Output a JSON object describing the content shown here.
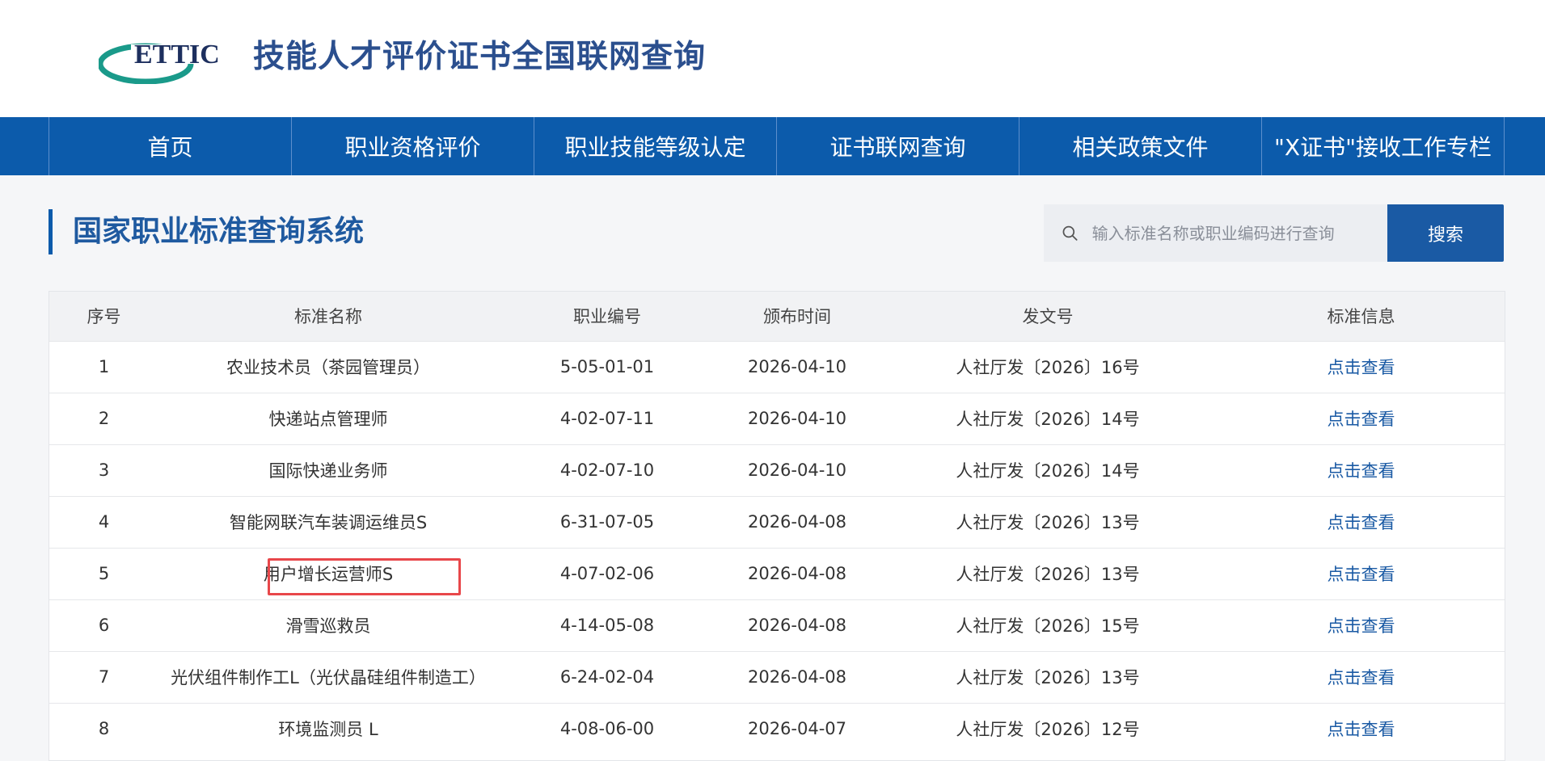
{
  "header": {
    "logo_text": "ETTIC",
    "site_title": "技能人才评价证书全国联网查询"
  },
  "nav": {
    "items": [
      {
        "label": "首页"
      },
      {
        "label": "职业资格评价"
      },
      {
        "label": "职业技能等级认定"
      },
      {
        "label": "证书联网查询"
      },
      {
        "label": "相关政策文件"
      },
      {
        "label": "\"X证书\"接收工作专栏"
      }
    ]
  },
  "main": {
    "page_title": "国家职业标准查询系统",
    "search": {
      "placeholder": "输入标准名称或职业编码进行查询",
      "button_label": "搜索",
      "icon": "search-icon"
    }
  },
  "table": {
    "columns": [
      "序号",
      "标准名称",
      "职业编号",
      "颁布时间",
      "发文号",
      "标准信息"
    ],
    "rows": [
      {
        "index": "1",
        "name": "农业技术员（茶园管理员）",
        "code": "5-05-01-01",
        "date": "2026-04-10",
        "doc": "人社厅发〔2026〕16号",
        "action": "点击查看"
      },
      {
        "index": "2",
        "name": "快递站点管理师",
        "code": "4-02-07-11",
        "date": "2026-04-10",
        "doc": "人社厅发〔2026〕14号",
        "action": "点击查看"
      },
      {
        "index": "3",
        "name": "国际快递业务师",
        "code": "4-02-07-10",
        "date": "2026-04-10",
        "doc": "人社厅发〔2026〕14号",
        "action": "点击查看"
      },
      {
        "index": "4",
        "name": "智能网联汽车装调运维员S",
        "code": "6-31-07-05",
        "date": "2026-04-08",
        "doc": "人社厅发〔2026〕13号",
        "action": "点击查看"
      },
      {
        "index": "5",
        "name": "用户增长运营师S",
        "code": "4-07-02-06",
        "date": "2026-04-08",
        "doc": "人社厅发〔2026〕13号",
        "action": "点击查看"
      },
      {
        "index": "6",
        "name": "滑雪巡救员",
        "code": "4-14-05-08",
        "date": "2026-04-08",
        "doc": "人社厅发〔2026〕15号",
        "action": "点击查看"
      },
      {
        "index": "7",
        "name": "光伏组件制作工L（光伏晶硅组件制造工）",
        "code": "6-24-02-04",
        "date": "2026-04-08",
        "doc": "人社厅发〔2026〕13号",
        "action": "点击查看"
      },
      {
        "index": "8",
        "name": "环境监测员 L",
        "code": "4-08-06-00",
        "date": "2026-04-07",
        "doc": "人社厅发〔2026〕12号",
        "action": "点击查看"
      }
    ]
  },
  "colors": {
    "nav_bg": "#0c5bab",
    "title_blue": "#1f5aa0",
    "link_blue": "#1a5aa4",
    "highlight_red": "#e8474a"
  }
}
